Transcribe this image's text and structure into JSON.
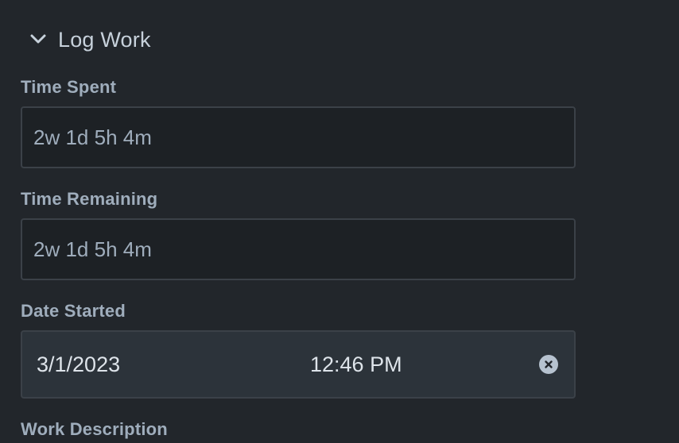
{
  "section": {
    "title": "Log Work",
    "toggle_icon": "chevron-down-icon"
  },
  "fields": {
    "time_spent": {
      "label": "Time Spent",
      "placeholder": "2w 1d 5h 4m",
      "value": ""
    },
    "time_remaining": {
      "label": "Time Remaining",
      "placeholder": "2w 1d 5h 4m",
      "value": ""
    },
    "date_started": {
      "label": "Date Started",
      "date": "3/1/2023",
      "time": "12:46 PM",
      "clear_icon": "clear-icon"
    },
    "work_description": {
      "label": "Work Description"
    }
  },
  "colors": {
    "background": "#22262b",
    "input_background": "#1d2125",
    "input_border": "#3b4148",
    "date_background": "#2c333a",
    "label_text": "#9fadbc",
    "primary_text": "#c7d1db"
  }
}
